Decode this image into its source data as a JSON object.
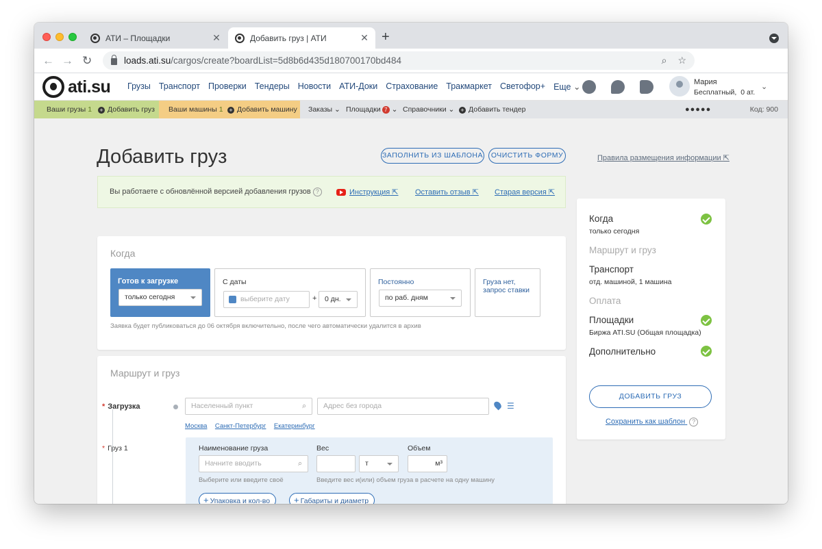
{
  "browser": {
    "tabs": [
      {
        "title": "АТИ – Площадки"
      },
      {
        "title": "Добавить груз | АТИ"
      }
    ],
    "url_host": "loads.ati.su",
    "url_path": "/cargos/create?boardList=5d8b6d435d180700170bd484"
  },
  "header": {
    "logo_text": "ati.su",
    "nav": [
      "Грузы",
      "Транспорт",
      "Проверки",
      "Тендеры",
      "Новости",
      "АТИ-Доки",
      "Страхование",
      "Тракмаркет",
      "Светофор+",
      "Еще"
    ],
    "user_name": "Мария",
    "user_plan": "Бесплатный,",
    "user_balance": "0 ат."
  },
  "subbar": {
    "my_cargo": "Ваши грузы",
    "my_cargo_count": "1",
    "add_cargo": "Добавить груз",
    "my_trucks": "Ваши машины",
    "my_trucks_count": "1",
    "add_truck": "Добавить машину",
    "orders": "Заказы",
    "boards": "Площадки",
    "boards_badge": "7",
    "references": "Справочники",
    "add_tender": "Добавить тендер",
    "code": "Код: 900"
  },
  "page": {
    "title": "Добавить груз",
    "fill_template": "ЗАПОЛНИТЬ ИЗ ШАБЛОНА",
    "clear_form": "ОЧИСТИТЬ ФОРМУ",
    "rules_link": "Правила размещения информации"
  },
  "banner": {
    "text": "Вы работаете с обновлённой версией добавления грузов",
    "instruction": "Инструкция",
    "feedback": "Оставить отзыв",
    "old_version": "Старая версия"
  },
  "when": {
    "title": "Когда",
    "ready_label": "Готов к загрузке",
    "ready_value": "только сегодня",
    "from_date_label": "С даты",
    "date_placeholder": "выберите дату",
    "plus": "+",
    "days_value": "0 дн.",
    "permanent_label": "Постоянно",
    "permanent_value": "по раб. дням",
    "no_cargo_label": "Груза нет, запрос ставки",
    "hint": "Заявка будет публиковаться до 06 октября включительно, после чего автоматически удалится в архив"
  },
  "route": {
    "title": "Маршрут и груз",
    "loading_label": "Загрузка",
    "city_placeholder": "Населенный пункт",
    "address_placeholder": "Адрес без города",
    "quick_cities": [
      "Москва",
      "Санкт-Петербург",
      "Екатеринбург"
    ],
    "cargo_label": "Груз 1",
    "cargo_name_label": "Наименование груза",
    "cargo_name_placeholder": "Начните вводить",
    "cargo_name_hint": "Выберите или введите своё",
    "weight_label": "Вес",
    "weight_unit": "т",
    "volume_label": "Объем",
    "volume_unit": "м³",
    "weight_hint": "Введите вес и(или) объем груза в расчете на одну машину",
    "packaging_button": "Упаковка и кол-во",
    "dimensions_button": "Габариты и диаметр"
  },
  "summary": {
    "when_title": "Когда",
    "when_value": "только сегодня",
    "route_title": "Маршрут и груз",
    "transport_title": "Транспорт",
    "transport_value": "отд. машиной, 1 машина",
    "payment_title": "Оплата",
    "boards_title": "Площадки",
    "boards_value": "Биржа ATI.SU (Общая площадка)",
    "extra_title": "Дополнительно",
    "add_button": "ДОБАВИТЬ ГРУЗ",
    "save_template": "Сохранить как шаблон"
  }
}
